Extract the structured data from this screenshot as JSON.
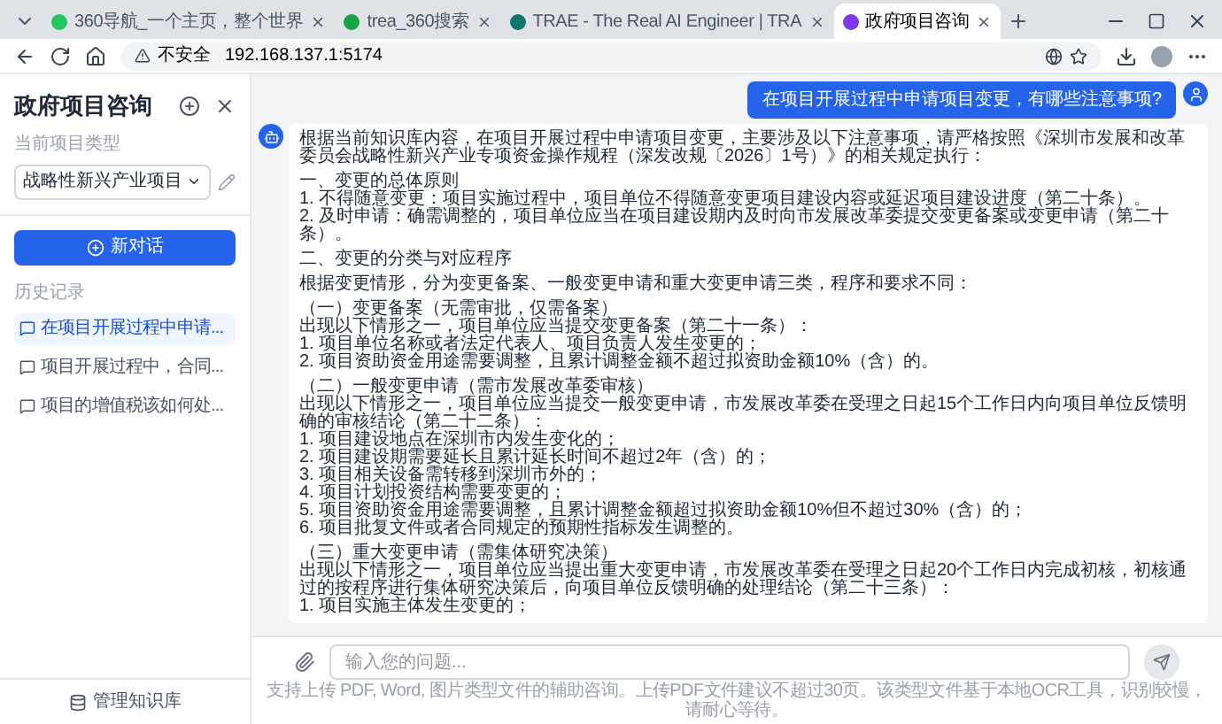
{
  "browser": {
    "tabs": [
      {
        "title": "360导航_一个主页，整个世界",
        "selected": false
      },
      {
        "title": "trea_360搜索",
        "selected": false
      },
      {
        "title": "TRAE - The Real AI Engineer | TRA",
        "selected": false
      },
      {
        "title": "政府项目咨询",
        "selected": true
      }
    ],
    "security": "不安全",
    "url": "192.168.137.1:5174"
  },
  "sidebar": {
    "title": "政府项目咨询",
    "project_type_label": "当前项目类型",
    "project_type": "战略性新兴产业项目",
    "new_chat": "新对话",
    "history_label": "历史记录",
    "history": [
      {
        "title": "在项目开展过程中申请...",
        "selected": true
      },
      {
        "title": "项目开展过程中，合同...",
        "selected": false
      },
      {
        "title": "项目的增值税该如何处...",
        "selected": false
      }
    ],
    "footer": "管理知识库"
  },
  "chat": {
    "user_message": "在项目开展过程中申请项目变更，有哪些注意事项?",
    "answer_blocks": [
      [
        "根据当前知识库内容，在项目开展过程中申请项目变更，主要涉及以下注意事项，请严格按照《深圳市发展和改革委员会战略性新兴产业专项资金操作规程（深发改规〔2026〕1号）》的相关规定执行："
      ],
      [
        "一、变更的总体原则",
        "1. 不得随意变更：项目实施过程中，项目单位不得随意变更项目建设内容或延迟项目建设进度（第二十条）。",
        "2. 及时申请：确需调整的，项目单位应当在项目建设期内及时向市发展改革委提交变更备案或变更申请（第二十条）。"
      ],
      [
        "二、变更的分类与对应程序"
      ],
      [
        "根据变更情形，分为变更备案、一般变更申请和重大变更申请三类，程序和要求不同："
      ],
      [
        "（一）变更备案（无需审批，仅需备案）",
        "出现以下情形之一，项目单位应当提交变更备案（第二十一条）：",
        "1. 项目单位名称或者法定代表人、项目负责人发生变更的；",
        "2. 项目资助资金用途需要调整，且累计调整金额不超过拟资助金额10%（含）的。"
      ],
      [
        "（二）一般变更申请（需市发展改革委审核）",
        "出现以下情形之一，项目单位应当提交一般变更申请，市发展改革委在受理之日起15个工作日内向项目单位反馈明确的审核结论（第二十二条）：",
        "1. 项目建设地点在深圳市内发生变化的；",
        "2. 项目建设期需要延长且累计延长时间不超过2年（含）的；",
        "3. 项目相关设备需转移到深圳市外的；",
        "4. 项目计划投资结构需要变更的；",
        "5. 项目资助资金用途需要调整，且累计调整金额超过拟资助金额10%但不超过30%（含）的；",
        "6. 项目批复文件或者合同规定的预期性指标发生调整的。"
      ],
      [
        "（三）重大变更申请（需集体研究决策）",
        "出现以下情形之一，项目单位应当提出重大变更申请，市发展改革委在受理之日起20个工作日内完成初核，初核通过的按程序进行集体研究决策后，向项目单位反馈明确的处理结论（第二十三条）：",
        "1. 项目实施主体发生变更的；"
      ]
    ],
    "input_placeholder": "输入您的问题...",
    "hint": "支持上传 PDF, Word, 图片类型文件的辅助咨询。上传PDF文件建议不超过30页。该类型文件基于本地OCR工具，识别较慢，请耐心等待。"
  }
}
